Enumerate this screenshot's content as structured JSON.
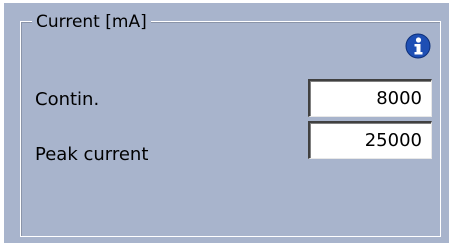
{
  "group": {
    "title": "Current [mA]"
  },
  "info_icon": {
    "name": "info-icon",
    "color": "#1e4fb4"
  },
  "fields": {
    "contin": {
      "label": "Contin.",
      "value": "8000"
    },
    "peak": {
      "label": "Peak current",
      "value": "25000"
    }
  },
  "colors": {
    "panel_background": "#a8b4cc",
    "field_background": "#ffffff",
    "text": "#000000"
  }
}
